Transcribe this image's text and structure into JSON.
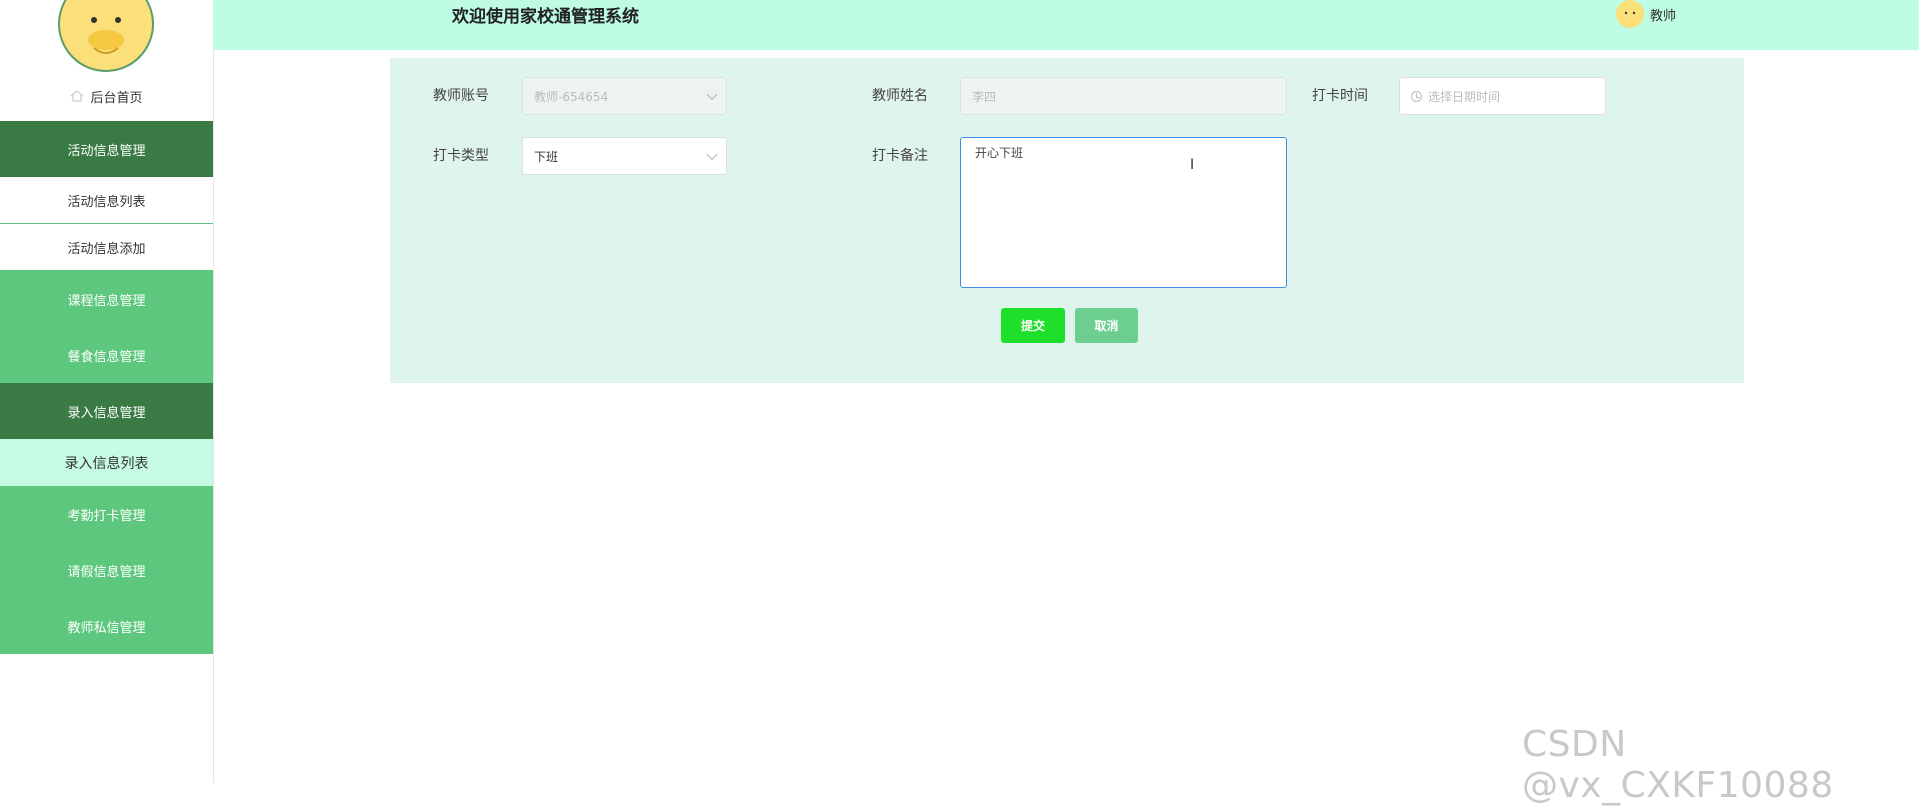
{
  "header": {
    "title": "欢迎使用家校通管理系统",
    "user_name": "教帅"
  },
  "sidebar": {
    "home_label": "后台首页",
    "items": [
      {
        "label": "活动信息管理",
        "style": "group-dark"
      },
      {
        "label": "活动信息列表",
        "style": "sub"
      },
      {
        "label": "活动信息添加",
        "style": "sub"
      },
      {
        "label": "课程信息管理",
        "style": "group-green"
      },
      {
        "label": "餐食信息管理",
        "style": "group-green"
      },
      {
        "label": "录入信息管理",
        "style": "group-dark"
      },
      {
        "label": "录入信息列表",
        "style": "sub-active"
      },
      {
        "label": "考勤打卡管理",
        "style": "group-green"
      },
      {
        "label": "请假信息管理",
        "style": "group-green"
      },
      {
        "label": "教师私信管理",
        "style": "group-green"
      }
    ]
  },
  "form": {
    "teacher_account_label": "教师账号",
    "teacher_account_value": "教师-654654",
    "teacher_name_label": "教师姓名",
    "teacher_name_value": "李四",
    "punch_time_label": "打卡时间",
    "punch_time_placeholder": "选择日期时间",
    "punch_type_label": "打卡类型",
    "punch_type_value": "下班",
    "punch_note_label": "打卡备注",
    "punch_note_value": "开心下班",
    "submit_label": "提交",
    "cancel_label": "取消"
  },
  "watermark": "CSDN @vx_CXKF10088",
  "colors": {
    "header_bg": "#bffce4",
    "panel_bg": "#dff4ec",
    "menu_dark": "#3a7a45",
    "menu_green": "#5dc87d",
    "submit": "#1ee02a",
    "cancel": "#6dcf8f"
  }
}
